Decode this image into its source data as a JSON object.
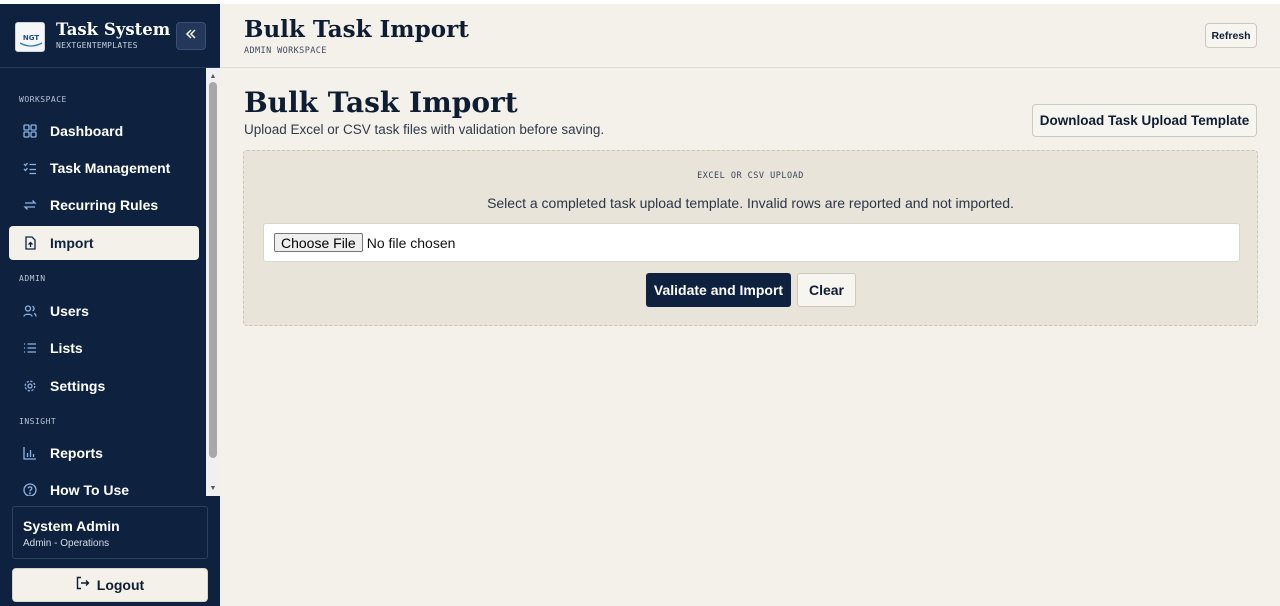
{
  "sidebar": {
    "brand_title": "Task System",
    "brand_subtitle": "NEXTGENTEMPLATES",
    "logo_text": "NGT",
    "collapse_icon": "double-chevron-left-icon",
    "sections": [
      {
        "label": "WORKSPACE"
      },
      {
        "label": "ADMIN"
      },
      {
        "label": "INSIGHT"
      }
    ],
    "items": [
      {
        "label": "Dashboard",
        "icon": "dashboard-grid-icon",
        "active": false
      },
      {
        "label": "Task Management",
        "icon": "checklist-icon",
        "active": false
      },
      {
        "label": "Recurring Rules",
        "icon": "repeat-arrows-icon",
        "active": false
      },
      {
        "label": "Import",
        "icon": "file-upload-icon",
        "active": true
      },
      {
        "label": "Users",
        "icon": "users-icon",
        "active": false
      },
      {
        "label": "Lists",
        "icon": "list-icon",
        "active": false
      },
      {
        "label": "Settings",
        "icon": "gear-icon",
        "active": false
      },
      {
        "label": "Reports",
        "icon": "bar-chart-icon",
        "active": false
      },
      {
        "label": "How To Use",
        "icon": "help-circle-icon",
        "active": false
      }
    ],
    "user": {
      "name": "System Admin",
      "role": "Admin - Operations"
    },
    "logout_label": "Logout",
    "logout_icon": "logout-arrow-icon"
  },
  "header": {
    "title": "Bulk Task Import",
    "subtitle": "ADMIN WORKSPACE",
    "refresh_label": "Refresh"
  },
  "main": {
    "title": "Bulk Task Import",
    "subtitle": "Upload Excel or CSV task files with validation before saving.",
    "download_label": "Download Task Upload Template",
    "upload": {
      "label": "EXCEL OR CSV UPLOAD",
      "description": "Select a completed task upload template. Invalid rows are reported and not imported.",
      "choose_label": "Choose File",
      "file_status": "No file chosen",
      "validate_label": "Validate and Import",
      "clear_label": "Clear"
    }
  },
  "colors": {
    "sidebar_bg": "#0e2240",
    "page_bg": "#f4f1ea",
    "upload_bg": "#e9e4da",
    "primary_button": "#0e2240"
  }
}
